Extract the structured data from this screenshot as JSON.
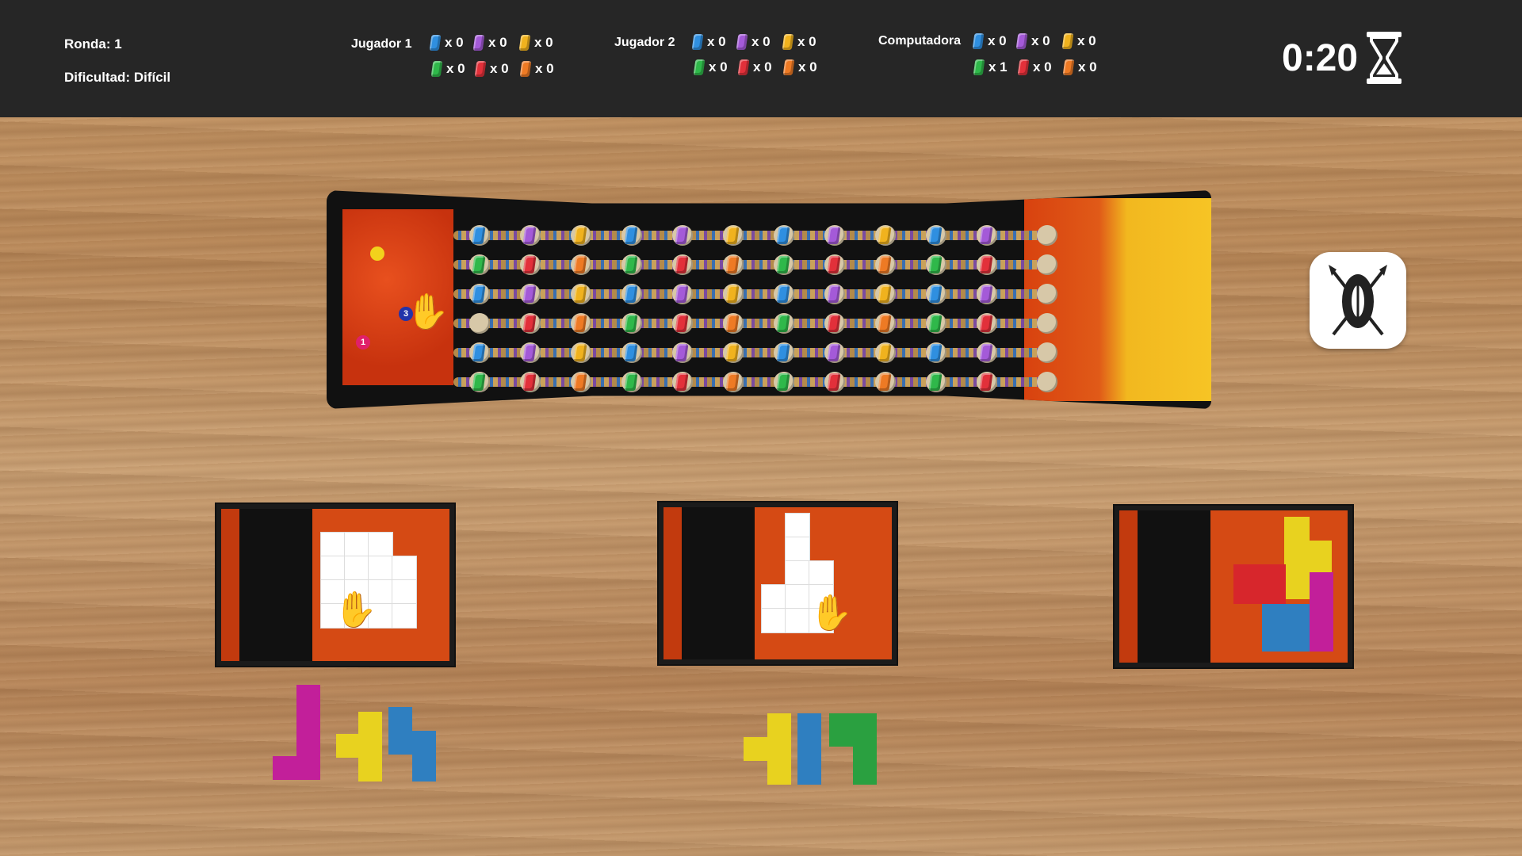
{
  "hud": {
    "round_label": "Ronda: 1",
    "difficulty_label": "Dificultad: Difícil",
    "timer": "0:20"
  },
  "players": [
    {
      "name": "Jugador 1",
      "gems": {
        "blue": "x 0",
        "purple": "x 0",
        "yellow": "x 0",
        "green": "x 0",
        "red": "x 0",
        "orange": "x 0"
      }
    },
    {
      "name": "Jugador 2",
      "gems": {
        "blue": "x 0",
        "purple": "x 0",
        "yellow": "x 0",
        "green": "x 0",
        "red": "x 0",
        "orange": "x 0"
      }
    },
    {
      "name": "Computadora",
      "gems": {
        "blue": "x 0",
        "purple": "x 0",
        "yellow": "x 0",
        "green": "x 1",
        "red": "x 0",
        "orange": "x 0"
      }
    }
  ],
  "tokens": [
    {
      "id": "yellow-token",
      "label": "",
      "color": "#f2d21c"
    },
    {
      "id": "blue-token",
      "label": "3",
      "color": "#2233aa"
    },
    {
      "id": "pink-token",
      "label": "1",
      "color": "#e0206a"
    }
  ],
  "colors": {
    "blue": "#2f8fe0",
    "purple": "#a45ad8",
    "yellow": "#f0b21e",
    "green": "#2fb84a",
    "red": "#e2303a",
    "orange": "#ee7a24",
    "piece_magenta": "#c21f9a",
    "piece_yellow": "#e8d21f",
    "piece_blue": "#2f7fc0",
    "piece_green": "#2aa040"
  },
  "icons": [
    "hourglass-icon",
    "shield-spears-icon",
    "hand-icon"
  ]
}
